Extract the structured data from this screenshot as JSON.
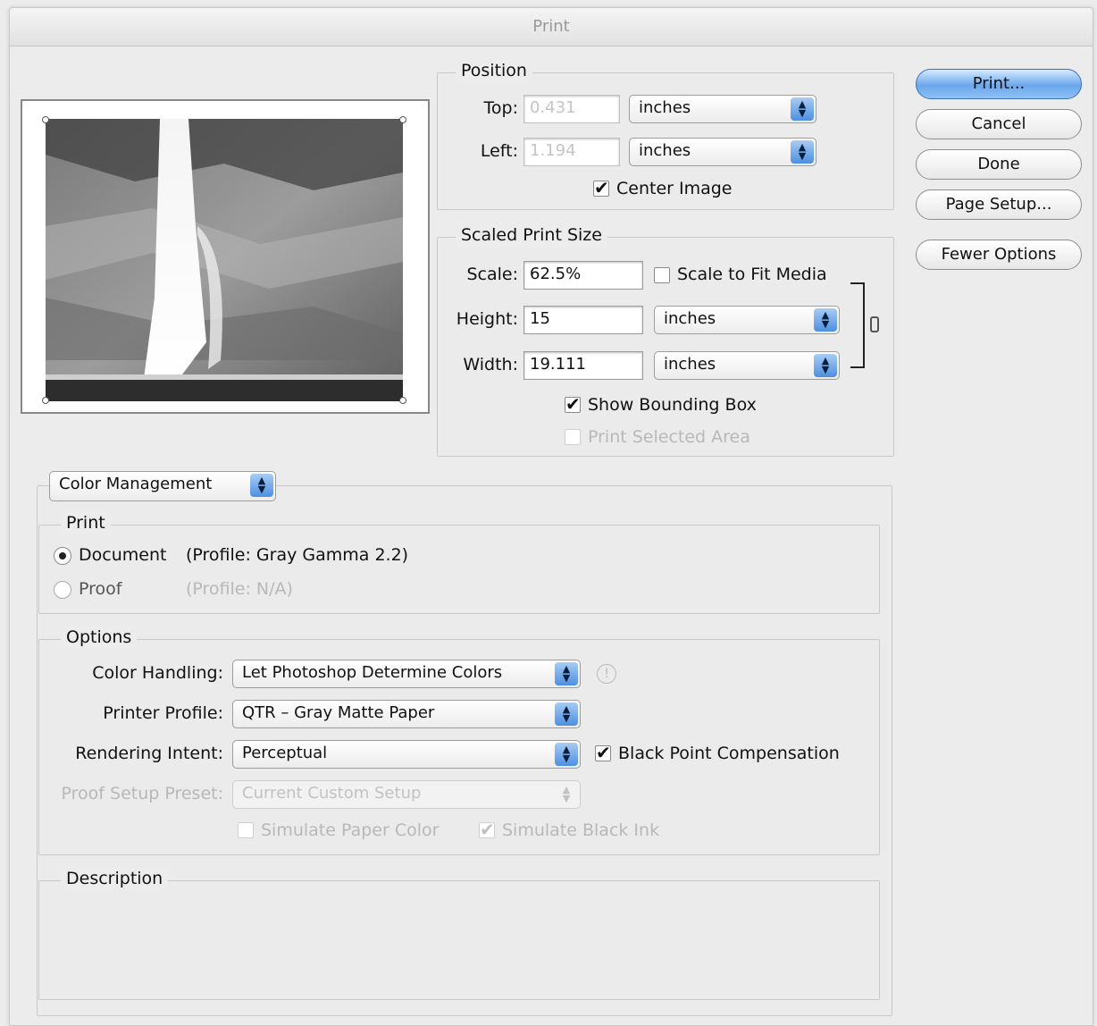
{
  "window": {
    "title": "Print"
  },
  "buttons": {
    "print": "Print...",
    "cancel": "Cancel",
    "done": "Done",
    "page_setup": "Page Setup...",
    "fewer_options": "Fewer Options"
  },
  "position": {
    "title": "Position",
    "top_label": "Top:",
    "top_value": "0.431",
    "top_unit": "inches",
    "left_label": "Left:",
    "left_value": "1.194",
    "left_unit": "inches",
    "center_image": "Center Image",
    "center_image_checked": true
  },
  "scaled": {
    "title": "Scaled Print Size",
    "scale_label": "Scale:",
    "scale_value": "62.5%",
    "scale_to_fit": "Scale to Fit Media",
    "height_label": "Height:",
    "height_value": "15",
    "height_unit": "inches",
    "width_label": "Width:",
    "width_value": "19.111",
    "width_unit": "inches",
    "show_bounding_box": "Show Bounding Box",
    "print_selected_area": "Print Selected Area"
  },
  "color_management": {
    "menu": "Color Management",
    "print_group": "Print",
    "document_label": "Document",
    "document_profile": "(Profile: Gray Gamma 2.2)",
    "proof_label": "Proof",
    "proof_profile": "(Profile: N/A)",
    "options_group": "Options",
    "color_handling_label": "Color Handling:",
    "color_handling_value": "Let Photoshop Determine Colors",
    "printer_profile_label": "Printer Profile:",
    "printer_profile_value": "QTR – Gray Matte Paper",
    "rendering_intent_label": "Rendering Intent:",
    "rendering_intent_value": "Perceptual",
    "black_point": "Black Point Compensation",
    "proof_setup_label": "Proof Setup Preset:",
    "proof_setup_value": "Current Custom Setup",
    "simulate_paper": "Simulate Paper Color",
    "simulate_ink": "Simulate Black Ink",
    "description_group": "Description"
  }
}
